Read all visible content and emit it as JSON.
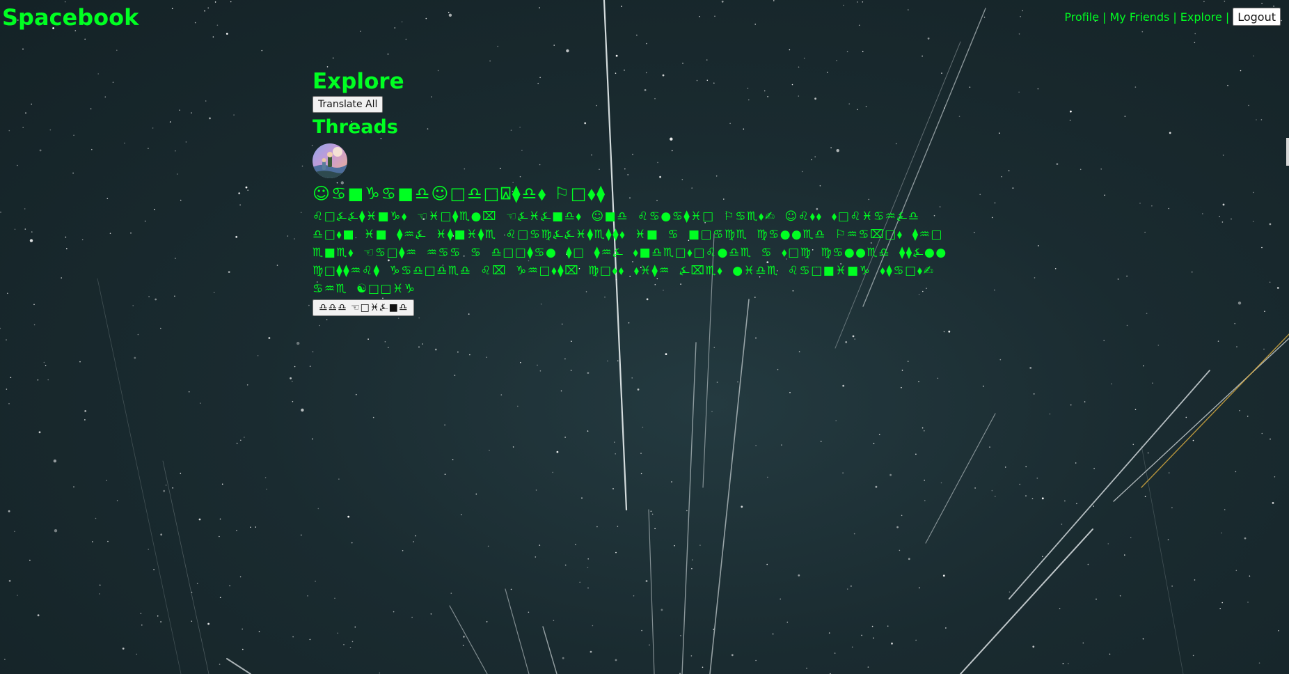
{
  "header": {
    "brand": "Spacebook",
    "nav": {
      "profile": "Profile",
      "my_friends": "My Friends",
      "explore": "Explore",
      "separator": "|",
      "logout": "Logout"
    }
  },
  "main": {
    "title": "Explore",
    "translate_all_label": "Translate All",
    "section_title": "Threads",
    "thread": {
      "title": "☺♋■♑♋■♎☺□♎□⍓⧫♎⬧ ⚐□⬧⧫",
      "body": "♌□⍼⍼⧫♓■♑⬧ ☜♓□⧫♏●⌧ ☜⍼♓⍼■♎⬧ ☺■♎ ♌♋●♋⧫♓□ ⚐♋♏⬧✍ ☺♌⬧⬧ ⬧□♌♓♋♒⍼♎ ♎□⬧■ ♓■ ⧫♒⍼ ♓⧫■♓⧫♏ ♌□♋♍⍼⍼♓⧫♏⧫⧫⬧ ♓■ ♋ ■□♋♍♏ ♍♋●●♏♎ ⚐♒♋⌧□⬧ ⧫♒□ ♏■♏⬧ ☜♋□⧫♒ ♒♋♋ ♋ ♎□□⧫♋● ⧫□ ⧫♒⍼ ⬧■♎♏□⬧□♌●♎♏ ♋ ⬧□♍ ♍♋●●♏♎ ⧫⧫⍼●● ♍□⧫⧫♒♌⧫ ♑♋♎□♎♏♎ ♌⌧ ♑♒□⬧⧫⌧ ♍□⬧⬧ ⬧♓⧫♒ ⍼⌧♏⬧ ●♓♎♏ ♌♋□■♓■♑ ⬧⧫♋□⬧✍ ♋♒♏ ☯□□♓♑",
      "see_more_label": "♎♎♎ ☜□♓⍼■♎"
    }
  },
  "colors": {
    "accent": "#00ff22",
    "background": "#18272c",
    "button_bg": "#f2f2f2"
  }
}
